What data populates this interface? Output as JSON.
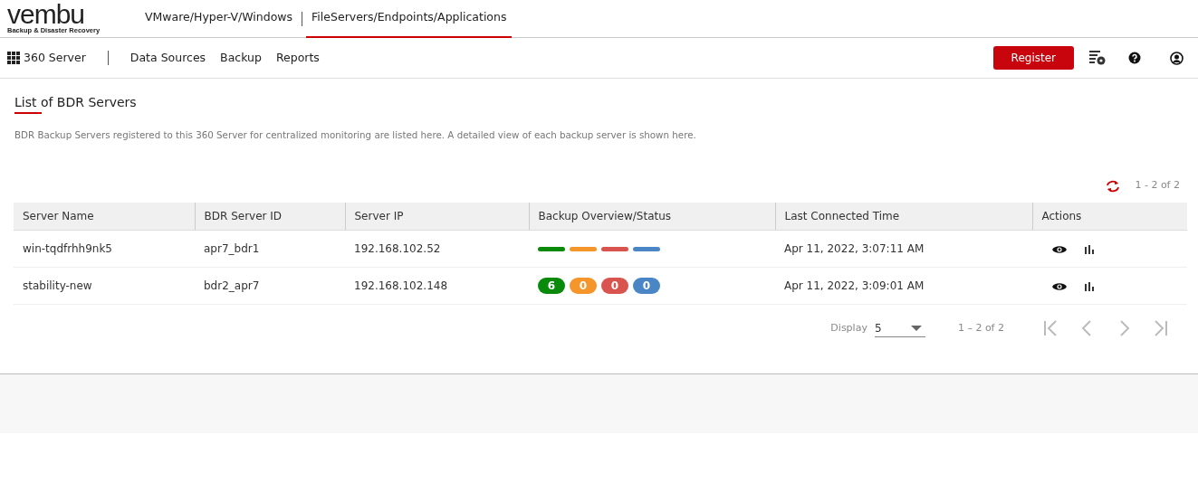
{
  "brand": {
    "logo": "vembu",
    "tagline": "Backup & Disaster Recovery"
  },
  "top_tabs": [
    {
      "label": "VMware/Hyper-V/Windows",
      "selected": false
    },
    {
      "label": "FileServers/Endpoints/Applications",
      "selected": true
    }
  ],
  "sub_nav": {
    "product": "360 Server",
    "items": [
      "Data Sources",
      "Backup",
      "Reports"
    ],
    "register": "Register"
  },
  "page": {
    "title": "List of BDR Servers",
    "description": "BDR Backup Servers registered to this 360 Server for centralized monitoring are listed here. A detailed view of each backup server is shown here.",
    "range": "1 - 2 of 2"
  },
  "table": {
    "columns": [
      "Server Name",
      "BDR Server ID",
      "Server IP",
      "Backup Overview/Status",
      "Last Connected Time",
      "Actions"
    ],
    "rows": [
      {
        "name": "win-tqdfrhh9nk5",
        "id": "apr7_bdr1",
        "ip": "192.168.102.52",
        "status": {
          "kind": "bars",
          "items": [
            {
              "color": "#0a8a0a"
            },
            {
              "color": "#f5962a"
            },
            {
              "color": "#d9534f"
            },
            {
              "color": "#4a86c5"
            }
          ]
        },
        "time": "Apr 11, 2022, 3:07:11 AM"
      },
      {
        "name": "stability-new",
        "id": "bdr2_apr7",
        "ip": "192.168.102.148",
        "status": {
          "kind": "counts",
          "items": [
            {
              "color": "#0a8a0a",
              "count": "6"
            },
            {
              "color": "#f5962a",
              "count": "0"
            },
            {
              "color": "#d9534f",
              "count": "0"
            },
            {
              "color": "#4a86c5",
              "count": "0"
            }
          ]
        },
        "time": "Apr 11, 2022, 3:09:01 AM"
      }
    ]
  },
  "paginator": {
    "display_label": "Display",
    "page_size": "5",
    "range": "1 – 2 of 2",
    "buttons": [
      {
        "kind": "first",
        "disabled": true
      },
      {
        "kind": "prev",
        "disabled": true
      },
      {
        "kind": "next",
        "disabled": true
      },
      {
        "kind": "last",
        "disabled": true
      }
    ]
  }
}
